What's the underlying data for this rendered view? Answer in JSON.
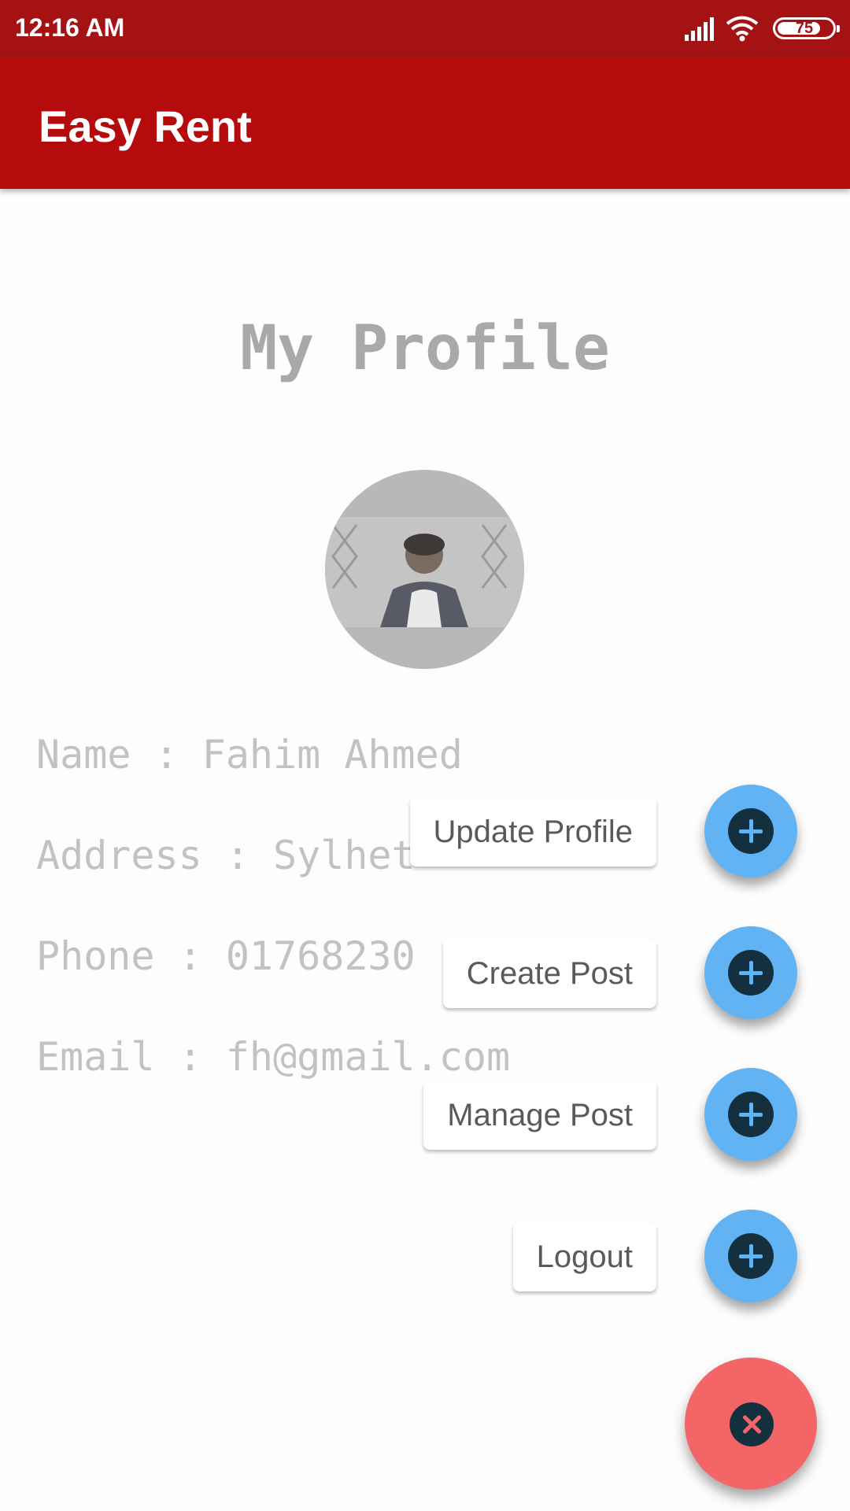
{
  "status_bar": {
    "time": "12:16 AM",
    "battery": "75",
    "icons": [
      "signal-icon",
      "wifi-icon",
      "battery-icon"
    ]
  },
  "app_bar": {
    "title": "Easy Rent"
  },
  "profile": {
    "heading": "My Profile",
    "fields": [
      "Name : Fahim Ahmed",
      "Address : Sylhet",
      "Phone : 01768230",
      "Email : fh@gmail.com"
    ]
  },
  "fab_menu": {
    "actions": [
      "Update Profile",
      "Create Post",
      "Manage Post",
      "Logout"
    ],
    "action_icon": "plus-icon",
    "close_icon": "close-icon"
  },
  "colors": {
    "status_bar": "#a51214",
    "app_bar": "#b50b0d",
    "fab_mini": "#62b3f3",
    "fab_main": "#f36566",
    "icon_badge": "#14303f"
  }
}
